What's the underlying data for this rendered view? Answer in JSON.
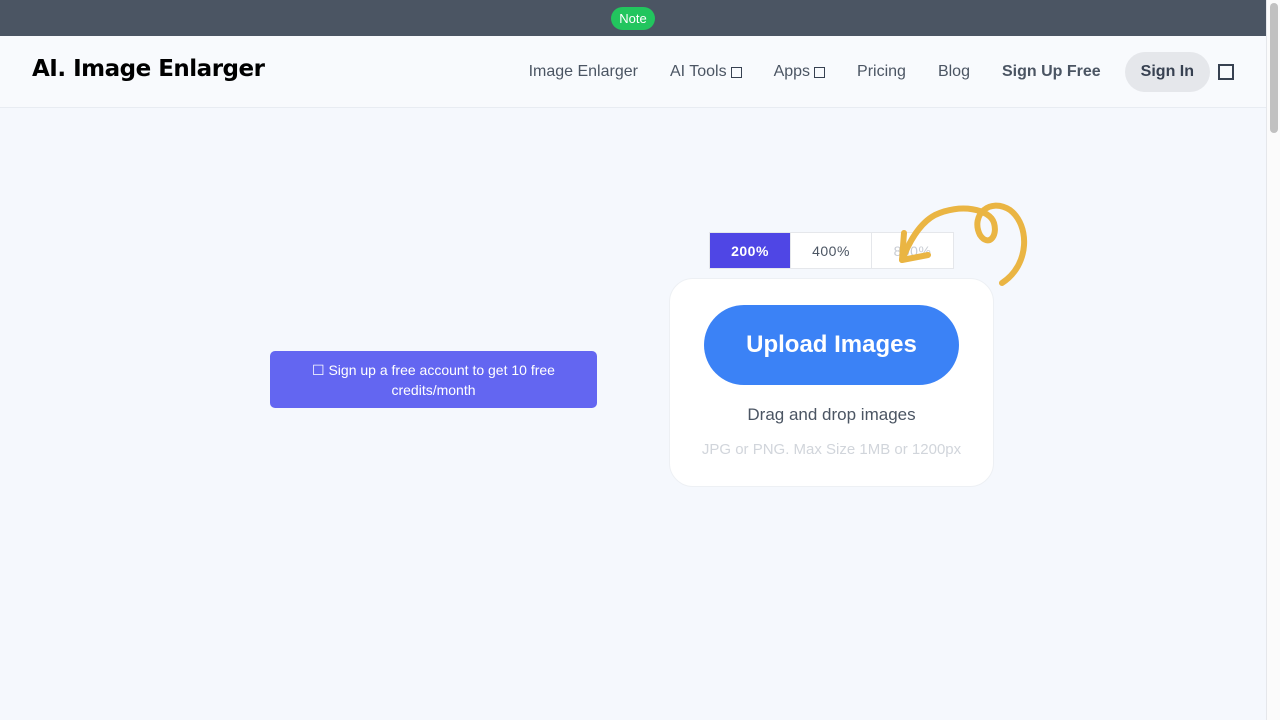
{
  "note_bar": {
    "label": "Note"
  },
  "header": {
    "logo": "AI. Image Enlarger",
    "nav": {
      "image_enlarger": "Image Enlarger",
      "ai_tools": "AI Tools",
      "apps": "Apps",
      "pricing": "Pricing",
      "blog": "Blog",
      "sign_up": "Sign Up Free",
      "sign_in": "Sign In"
    }
  },
  "promo": {
    "label": "☐ Sign up a free account to get 10 free credits/month"
  },
  "scale_tabs": {
    "selected": "200%",
    "options": [
      "200%",
      "400%",
      "800%"
    ]
  },
  "upload": {
    "button_label": "Upload Images",
    "drag_text": "Drag and drop images",
    "hint": "JPG or PNG. Max Size 1MB or 1200px"
  },
  "colors": {
    "accent": "#3b82f6",
    "tab_active": "#4f46e5",
    "promo": "#6366f1",
    "note": "#22c55e",
    "arrow": "#eab543"
  }
}
